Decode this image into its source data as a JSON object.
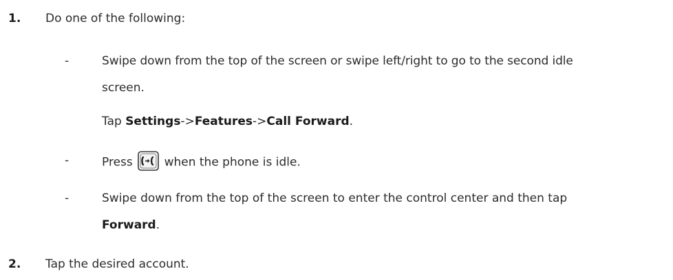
{
  "steps": [
    {
      "number": "1.",
      "text": "Do one of the following:",
      "options": [
        {
          "line1": "Swipe down from the top of the screen or swipe left/right to go to the second idle",
          "line2": "screen.",
          "tap_prefix": "Tap ",
          "menu_path": [
            "Settings",
            "Features",
            "Call Forward"
          ],
          "separator": "->",
          "tap_suffix": "."
        },
        {
          "prefix": "Press ",
          "icon": "call-forward-key-icon",
          "suffix": " when the phone is idle."
        },
        {
          "line1": "Swipe down from the top of the screen to enter the control center and then tap",
          "bold": "Forward",
          "suffix": "."
        }
      ]
    },
    {
      "number": "2.",
      "text": "Tap the desired account."
    }
  ],
  "dash": "-"
}
